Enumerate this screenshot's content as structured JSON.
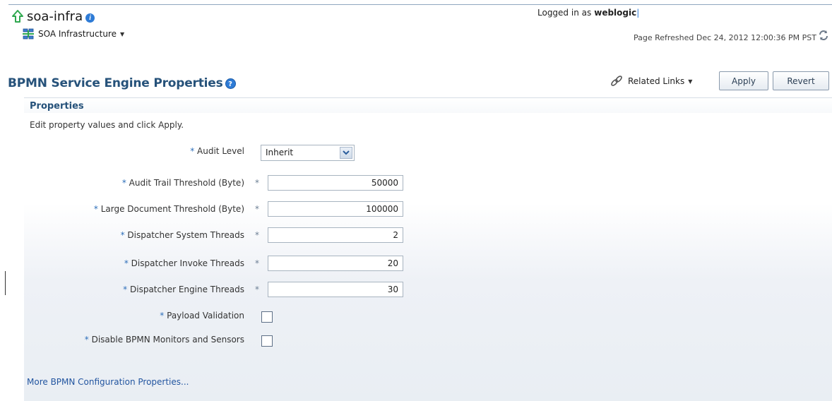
{
  "header": {
    "app_title": "soa-infra",
    "menu_label": "SOA Infrastructure",
    "logged_in_prefix": "Logged in as",
    "user": "weblogic",
    "cursor": "|",
    "refreshed": "Page Refreshed Dec 24, 2012 12:00:36 PM PST"
  },
  "page": {
    "title": "BPMN Service Engine Properties",
    "related_links": "Related Links",
    "apply_label": "Apply",
    "revert_label": "Revert"
  },
  "panel": {
    "title": "Properties",
    "instructions": "Edit property values and click Apply."
  },
  "fields": {
    "required_marker": "*",
    "audit_level": {
      "label": "Audit Level",
      "value": "Inherit"
    },
    "audit_trail_threshold": {
      "label": "Audit Trail Threshold (Byte)",
      "value": "50000"
    },
    "large_document_threshold": {
      "label": "Large Document Threshold (Byte)",
      "value": "100000"
    },
    "dispatcher_system_threads": {
      "label": "Dispatcher System Threads",
      "value": "2"
    },
    "dispatcher_invoke_threads": {
      "label": "Dispatcher Invoke Threads",
      "value": "20"
    },
    "dispatcher_engine_threads": {
      "label": "Dispatcher Engine Threads",
      "value": "30"
    },
    "payload_validation": {
      "label": "Payload Validation",
      "checked": false
    },
    "disable_monitors": {
      "label": "Disable BPMN Monitors and Sensors",
      "checked": false
    }
  },
  "footer": {
    "more_link": "More BPMN Configuration Properties..."
  },
  "colors": {
    "title_blue": "#26527a",
    "link_blue": "#2355a0",
    "accent_green": "#2fa84f",
    "info_blue": "#2e7bd6"
  },
  "icons": {
    "up": "up-arrow-icon",
    "info": "info-icon",
    "soa": "soa-infrastructure-icon",
    "refresh": "refresh-icon",
    "help": "help-icon",
    "link": "chain-link-icon"
  }
}
